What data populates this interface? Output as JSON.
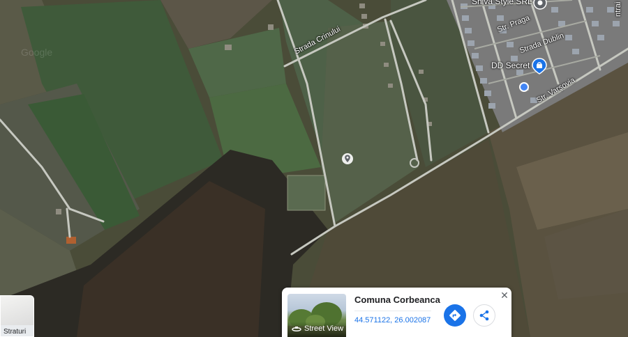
{
  "map": {
    "street_labels": {
      "crinului": "Strada Crinului",
      "praga": "Str. Praga",
      "dublin": "Strada Dublin",
      "varsovia": "Str. Varșovia",
      "partial_right": "ntrai"
    },
    "pois": {
      "shiva": "Shiva Style SRL",
      "dd_secret": "DD Secret"
    },
    "watermark": "Google"
  },
  "layers": {
    "label": "Straturi"
  },
  "card": {
    "title": "Comuna Corbeanca",
    "coordinates": "44.571122, 26.002087",
    "street_view_label": "Street View",
    "close_icon": "close-icon",
    "directions_icon": "directions-icon",
    "share_icon": "share-icon"
  },
  "colors": {
    "accent": "#1a73e8",
    "location_dot": "#4285f4"
  }
}
